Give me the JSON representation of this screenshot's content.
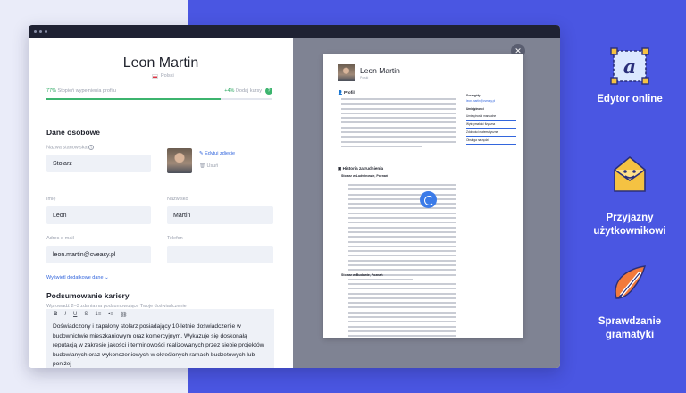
{
  "editor": {
    "name": "Leon Martin",
    "language": "Polski",
    "progress_percent": "77%",
    "progress_label": "Stopień wypełnienia profilu",
    "progress_fraction": 0.77,
    "bonus_percent": "+4%",
    "bonus_label": "Dodaj kursy",
    "personal_title": "Dane osobowe",
    "job_title_label": "Nazwa stanowiska",
    "job_title_value": "Stolarz",
    "edit_photo": "Edytuj zdjęcie",
    "delete_photo": "Usuń",
    "first_name_label": "Imię",
    "first_name_value": "Leon",
    "last_name_label": "Nazwisko",
    "last_name_value": "Martin",
    "email_label": "Adres e-mail",
    "email_value": "leon.martin@cveasy.pl",
    "phone_label": "Telefon",
    "phone_value": "",
    "more_details": "Wyświetl dodatkowe dane",
    "summary_title": "Podsumowanie kariery",
    "summary_hint": "Wprowadź 2–3 zdania na podsumowujące Twoje doświadczenie",
    "summary_text": "Doświadczony i zapalony stolarz posiadający 10-letnie doświadczenie w budownictwie mieszkaniowym oraz komercyjnym. Wykazuje się doskonałą reputacją w zakresie jakości i terminowości realizowanych przez siebie projektów budowlanych oraz wykonczeniowych w określonych ramach budżetowych lub poniżej",
    "toolbar": {
      "bold": "B",
      "italic": "I",
      "underline": "U",
      "strike": "S",
      "ol": "1≡",
      "ul": "•≡",
      "link": "🔗"
    }
  },
  "preview": {
    "close": "✕",
    "name": "Leon Martin",
    "language": "Polski",
    "profile_heading": "Profil",
    "experience_heading": "Historia zatrudnienia",
    "job1": "Stolarz w Ludwinowie, Poznań",
    "job2": "Stolarz w Budowie, Poznań",
    "side_contact": "Szczegóły",
    "side_email": "leon.martin@cveasy.pl",
    "side_skills": "Umiejętności",
    "skills": [
      "Umiejętności manualne",
      "Wytrzymałość fizyczna",
      "Zdolności matematyczne",
      "Obsługa narzędzi"
    ]
  },
  "features": [
    {
      "icon": "editor-icon",
      "label": "Edytor online"
    },
    {
      "icon": "friendly-icon",
      "label": "Przyjazny użytkownikowi"
    },
    {
      "icon": "grammar-icon",
      "label": "Sprawdzanie gramatyki"
    }
  ],
  "colors": {
    "brand_blue": "#4a56e2",
    "accent_green": "#3cb46e",
    "link_blue": "#3366dd",
    "icon_yellow": "#f5c242",
    "icon_orange": "#f27a3c"
  }
}
